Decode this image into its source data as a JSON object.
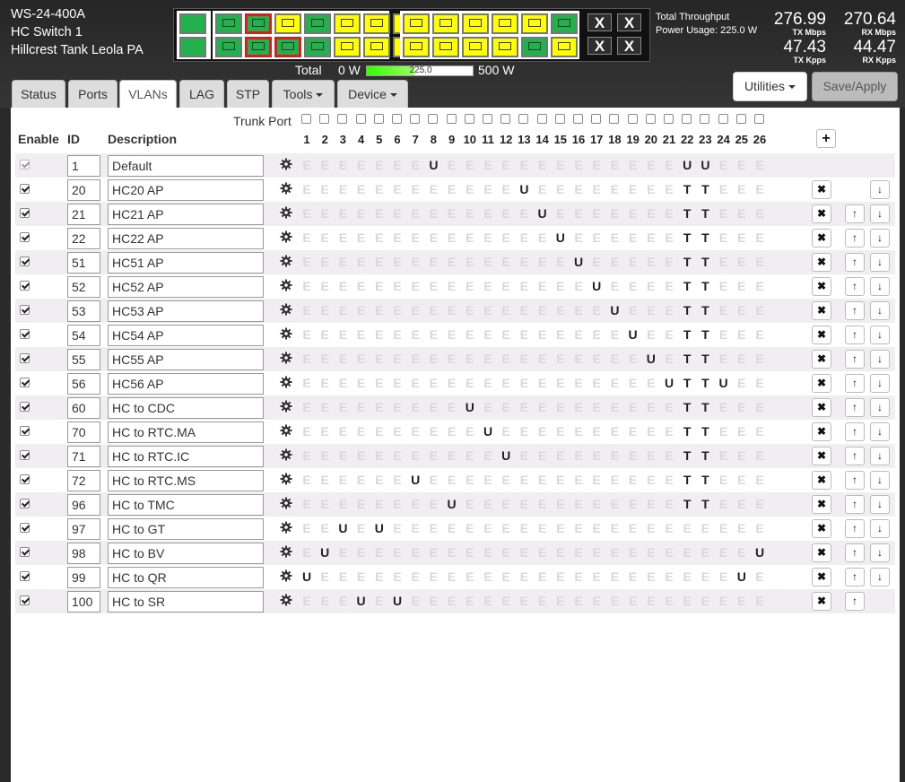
{
  "device": {
    "model": "WS-24-400A",
    "name": "HC Switch 1",
    "location": "Hillcrest Tank Leola PA"
  },
  "ports_panel": {
    "group1": [
      [
        "green",
        "redgreen",
        "yellow",
        "xgreen",
        "yellow",
        "yellow",
        "yellow"
      ],
      [
        "green",
        "redgreen",
        "redgreen",
        "xgreen",
        "yellow",
        "yellow",
        "yellow"
      ]
    ],
    "group2": [
      [
        "yellow",
        "yellow",
        "yellow",
        "yellow",
        "yellow",
        "xgreen"
      ],
      [
        "yellow",
        "yellow",
        "yellow",
        "yellow",
        "xgreen",
        "yellow"
      ]
    ],
    "sfp": [
      "X",
      "X",
      "X",
      "X"
    ]
  },
  "power": {
    "label": "Total",
    "min": "0 W",
    "max": "500 W",
    "value_label": "225.0",
    "fraction": 0.45
  },
  "throughput": {
    "label": "Total Throughput",
    "usage": "Power Usage: 225.0 W",
    "tx_mbps": "276.99",
    "tx_mbps_label": "TX Mbps",
    "rx_mbps": "270.64",
    "rx_mbps_label": "RX Mbps",
    "tx_kpps": "47.43",
    "tx_kpps_label": "TX Kpps",
    "rx_kpps": "44.47",
    "rx_kpps_label": "RX Kpps"
  },
  "tabs": [
    "Status",
    "Ports",
    "VLANs",
    "LAG",
    "STP",
    "Tools",
    "Device"
  ],
  "active_tab": "VLANs",
  "buttons": {
    "utilities": "Utilities",
    "save": "Save/Apply"
  },
  "table": {
    "trunk_label": "Trunk Port",
    "col_enable": "Enable",
    "col_id": "ID",
    "col_desc": "Description",
    "add": "+",
    "ports": [
      "1",
      "2",
      "3",
      "4",
      "5",
      "6",
      "7",
      "8",
      "9",
      "10",
      "11",
      "12",
      "13",
      "14",
      "15",
      "16",
      "17",
      "18",
      "19",
      "20",
      "21",
      "22",
      "23",
      "24",
      "25",
      "26"
    ],
    "vlans": [
      {
        "id": "1",
        "desc": "Default",
        "ports": "EEEEEEEUEEEEEEEEEEEEEUUEEE",
        "del": false,
        "up": false,
        "down": false,
        "locked": true
      },
      {
        "id": "20",
        "desc": "HC20 AP",
        "ports": "EEEEEEEEEEEEUEEEEEEEETTEEE",
        "del": true,
        "up": false,
        "down": true
      },
      {
        "id": "21",
        "desc": "HC21 AP",
        "ports": "EEEEEEEEEEEEEUEEEEEEETTEEE",
        "del": true,
        "up": true,
        "down": true
      },
      {
        "id": "22",
        "desc": "HC22 AP",
        "ports": "EEEEEEEEEEEEEEUEEEEEETTEEE",
        "del": true,
        "up": true,
        "down": true
      },
      {
        "id": "51",
        "desc": "HC51 AP",
        "ports": "EEEEEEEEEEEEEEEUEEEEETTEEE",
        "del": true,
        "up": true,
        "down": true
      },
      {
        "id": "52",
        "desc": "HC52 AP",
        "ports": "EEEEEEEEEEEEEEEEUEEEETTEEE",
        "del": true,
        "up": true,
        "down": true
      },
      {
        "id": "53",
        "desc": "HC53 AP",
        "ports": "EEEEEEEEEEEEEEEEEUEEETTEEE",
        "del": true,
        "up": true,
        "down": true
      },
      {
        "id": "54",
        "desc": "HC54 AP",
        "ports": "EEEEEEEEEEEEEEEEEEUEETTEEE",
        "del": true,
        "up": true,
        "down": true
      },
      {
        "id": "55",
        "desc": "HC55 AP",
        "ports": "EEEEEEEEEEEEEEEEEEEUETTEEE",
        "del": true,
        "up": true,
        "down": true
      },
      {
        "id": "56",
        "desc": "HC56 AP",
        "ports": "EEEEEEEEEEEEEEEEEEEEUTTUEE",
        "del": true,
        "up": true,
        "down": true
      },
      {
        "id": "60",
        "desc": "HC to CDC",
        "ports": "EEEEEEEEEUEEEEEEEEEEETTEEE",
        "del": true,
        "up": true,
        "down": true
      },
      {
        "id": "70",
        "desc": "HC to RTC.MA",
        "ports": "EEEEEEEEEEUEEEEEEEEEETTEEE",
        "del": true,
        "up": true,
        "down": true
      },
      {
        "id": "71",
        "desc": "HC to RTC.IC",
        "ports": "EEEEEEEEEEEUEEEEEEEEETTEEE",
        "del": true,
        "up": true,
        "down": true
      },
      {
        "id": "72",
        "desc": "HC to RTC.MS",
        "ports": "EEEEEEUEEEEEEEEEEEEEETTEEE",
        "del": true,
        "up": true,
        "down": true
      },
      {
        "id": "96",
        "desc": "HC to TMC",
        "ports": "EEEEEEEEUEEEEEEEEEEEETTEEE",
        "del": true,
        "up": true,
        "down": true
      },
      {
        "id": "97",
        "desc": "HC to GT",
        "ports": "EEUEUEEEEEEEEEEEEEEEEEEEEE",
        "del": true,
        "up": true,
        "down": true
      },
      {
        "id": "98",
        "desc": "HC to BV",
        "ports": "EUEEEEEEEEEEEEEEEEEEEEEEEU",
        "del": true,
        "up": true,
        "down": true
      },
      {
        "id": "99",
        "desc": "HC to QR",
        "ports": "UEEEEEEEEEEEEEEEEEEEEEEEUE",
        "del": true,
        "up": true,
        "down": true
      },
      {
        "id": "100",
        "desc": "HC to SR",
        "ports": "EEEUEUEEEEEEEEEEEEEEEEEEEE",
        "del": true,
        "up": true,
        "down": false
      }
    ]
  }
}
